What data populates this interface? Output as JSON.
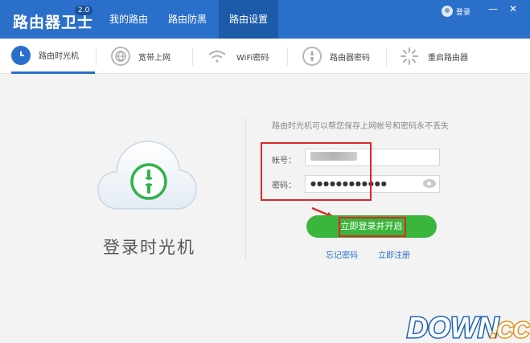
{
  "app": {
    "title": "路由器卫士",
    "version": "2.0"
  },
  "nav": {
    "tabs": [
      "我的路由",
      "路由防黑",
      "路由设置"
    ],
    "active": 2
  },
  "login": {
    "label": "登录"
  },
  "window": {
    "minimize": "—",
    "close": "✕"
  },
  "subtabs": [
    {
      "label": "路由时光机",
      "icon": "clock-icon",
      "active": true
    },
    {
      "label": "宽带上网",
      "icon": "globe-icon",
      "active": false
    },
    {
      "label": "WiFi密码",
      "icon": "wifi-icon",
      "active": false
    },
    {
      "label": "路由器密码",
      "icon": "lock-icon",
      "active": false
    },
    {
      "label": "重启路由器",
      "icon": "restart-icon",
      "active": false
    }
  ],
  "main": {
    "caption": "登录时光机",
    "hint": "路由时光机可以帮您保存上网帐号和密码永不丢失",
    "account_label": "帐号：",
    "password_label": "密码：",
    "password_value": "●●●●●●●●●●●●",
    "submit_label": "立即登录并开启",
    "forgot_label": "忘记密码",
    "register_label": "立即注册"
  },
  "watermark": {
    "text": "DOWN",
    "suffix": ".CC"
  },
  "colors": {
    "brand": "#2a6fc9",
    "success": "#3cb53c",
    "annotation": "#e0262a"
  }
}
